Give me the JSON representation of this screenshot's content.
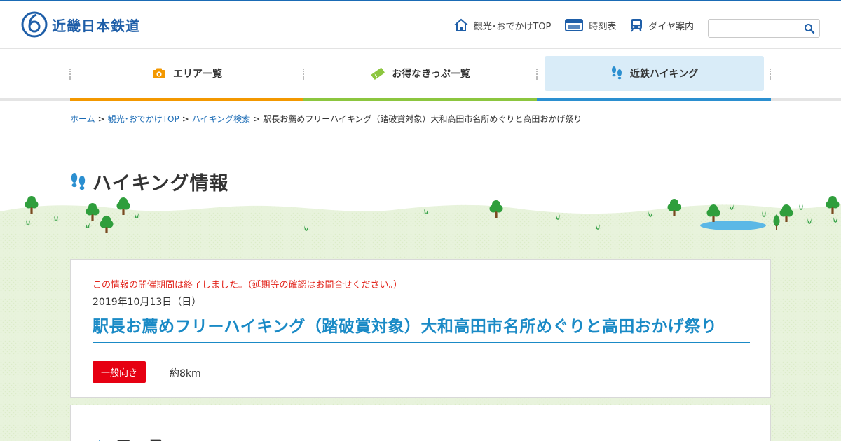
{
  "brand": {
    "name": "近畿日本鉄道",
    "color": "#1e5ea8"
  },
  "header_nav": [
    {
      "label": "観光･おでかけTOP",
      "icon": "home-icon"
    },
    {
      "label": "時刻表",
      "icon": "timetable-icon"
    },
    {
      "label": "ダイヤ案内",
      "icon": "train-icon"
    }
  ],
  "search": {
    "placeholder": ""
  },
  "main_nav": [
    {
      "label": "エリア一覧",
      "icon": "camera-icon",
      "accent": "#f39800"
    },
    {
      "label": "お得なきっぷ一覧",
      "icon": "ticket-icon",
      "accent": "#8cc63f"
    },
    {
      "label": "近鉄ハイキング",
      "icon": "footprints-icon",
      "accent": "#2b8fd0",
      "active": true
    }
  ],
  "breadcrumb": {
    "items": [
      "ホーム",
      "観光･おでかけTOP",
      "ハイキング検索"
    ],
    "current": "駅長お薦めフリーハイキング（踏破賞対象）大和高田市名所めぐりと高田おかげ祭り"
  },
  "page": {
    "title": "ハイキング情報"
  },
  "event": {
    "notice": "この情報の開催期間は終了しました。（延期等の確認はお問合せください。）",
    "date": "2019年10月13日（日）",
    "title": "駅長お薦めフリーハイキング（踏破賞対象）大和高田市名所めぐりと高田おかげ祭り",
    "level": "一般向き",
    "distance": "約8km"
  },
  "course": {
    "heading": "コース"
  }
}
